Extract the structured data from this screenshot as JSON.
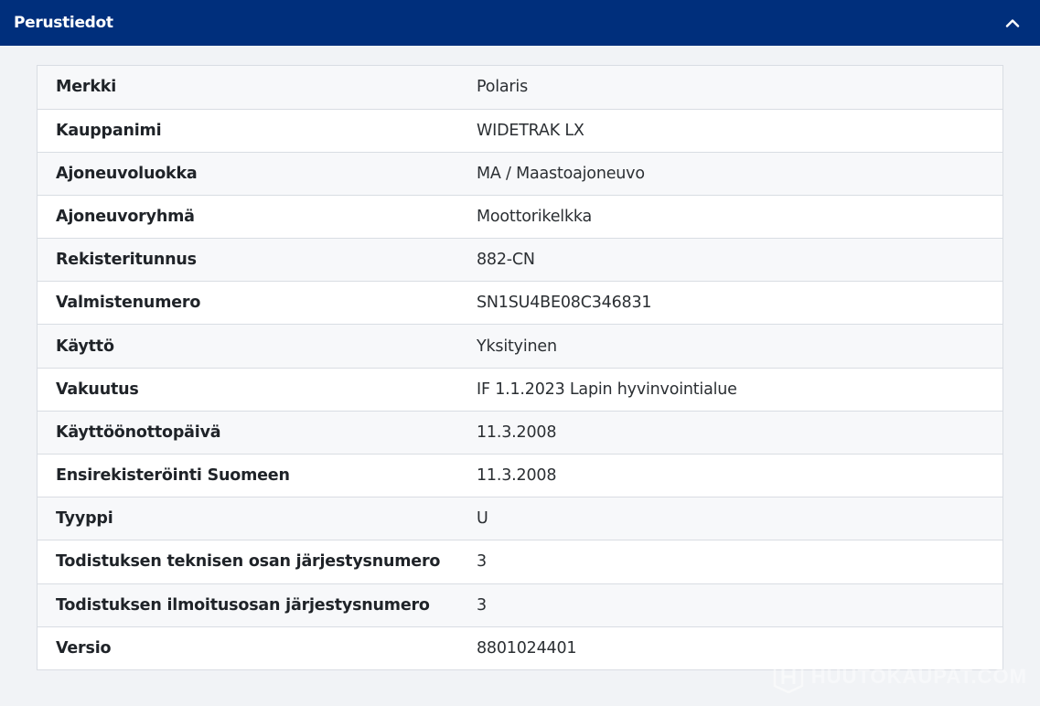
{
  "section": {
    "title": "Perustiedot",
    "toggle_icon": "chevron-up-icon"
  },
  "colors": {
    "header_bg": "#002f7c",
    "page_bg": "#f1f3f6",
    "row_alt_bg": "#f7f8fa",
    "border": "#d9dde3"
  },
  "rows": [
    {
      "label": "Merkki",
      "value": "Polaris"
    },
    {
      "label": "Kauppanimi",
      "value": "WIDETRAK LX"
    },
    {
      "label": "Ajoneuvoluokka",
      "value": "MA / Maastoajoneuvo"
    },
    {
      "label": "Ajoneuvoryhmä",
      "value": "Moottorikelkka"
    },
    {
      "label": "Rekisteritunnus",
      "value": "882-CN"
    },
    {
      "label": "Valmistenumero",
      "value": "SN1SU4BE08C346831"
    },
    {
      "label": "Käyttö",
      "value": "Yksityinen"
    },
    {
      "label": "Vakuutus",
      "value": "IF 1.1.2023 Lapin hyvinvointialue"
    },
    {
      "label": "Käyttöönottopäivä",
      "value": "11.3.2008"
    },
    {
      "label": "Ensirekisteröinti Suomeen",
      "value": "11.3.2008"
    },
    {
      "label": "Tyyppi",
      "value": "U"
    },
    {
      "label": "Todistuksen teknisen osan järjestysnumero",
      "value": "3"
    },
    {
      "label": "Todistuksen ilmoitusosan järjestysnumero",
      "value": "3"
    },
    {
      "label": "Versio",
      "value": "8801024401"
    }
  ],
  "watermark": {
    "text": "HUUTOKAUPAT.COM",
    "icon": "huutokaupat-logo-icon"
  }
}
